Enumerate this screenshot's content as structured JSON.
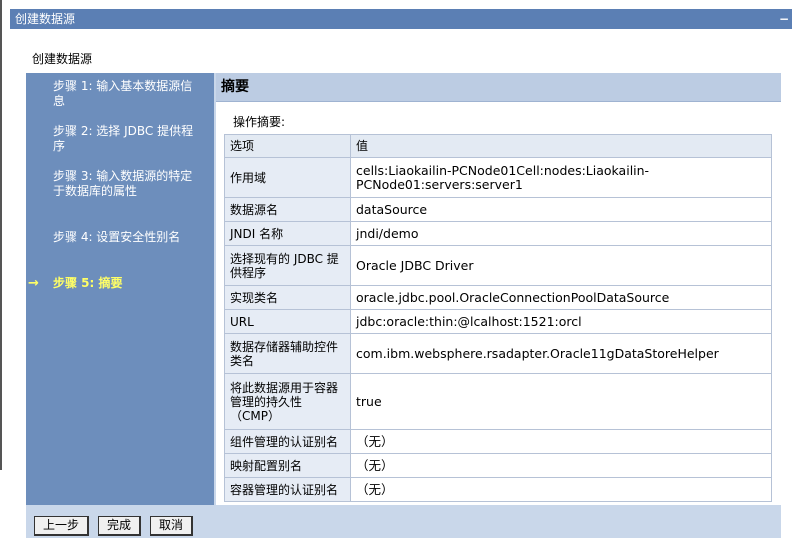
{
  "window": {
    "title": "创建数据源",
    "minimize_glyph": "−"
  },
  "page_title": "创建数据源",
  "steps": [
    {
      "label": "步骤 1: 输入基本数据源信息"
    },
    {
      "label": "步骤 2: 选择 JDBC 提供程序"
    },
    {
      "label": "步骤 3: 输入数据源的特定于数据库的属性"
    },
    {
      "label": "步骤 4: 设置安全性别名"
    },
    {
      "label": "步骤 5: 摘要",
      "current": true
    }
  ],
  "current_arrow": "→",
  "summary": {
    "heading": "摘要",
    "operation_label": "操作摘要:",
    "columns": [
      "选项",
      "值"
    ],
    "rows": [
      {
        "key": "作用域",
        "value": "cells:Liaokailin-PCNode01Cell:nodes:Liaokailin-PCNode01:servers:server1"
      },
      {
        "key": "数据源名",
        "value": "dataSource"
      },
      {
        "key": "JNDI 名称",
        "value": "jndi/demo"
      },
      {
        "key": "选择现有的 JDBC 提供程序",
        "value": "Oracle JDBC Driver"
      },
      {
        "key": "实现类名",
        "value": "oracle.jdbc.pool.OracleConnectionPoolDataSource"
      },
      {
        "key": "URL",
        "value": "jdbc:oracle:thin:@lcalhost:1521:orcl"
      },
      {
        "key": "数据存储器辅助控件类名",
        "value": "com.ibm.websphere.rsadapter.Oracle11gDataStoreHelper"
      },
      {
        "key": "将此数据源用于容器管理的持久性（CMP）",
        "value": "true"
      },
      {
        "key": "组件管理的认证别名",
        "value": "（无）"
      },
      {
        "key": "映射配置别名",
        "value": "（无）"
      },
      {
        "key": "容器管理的认证别名",
        "value": "（无）"
      }
    ]
  },
  "buttons": {
    "previous": "上一步",
    "finish": "完成",
    "cancel": "取消"
  }
}
